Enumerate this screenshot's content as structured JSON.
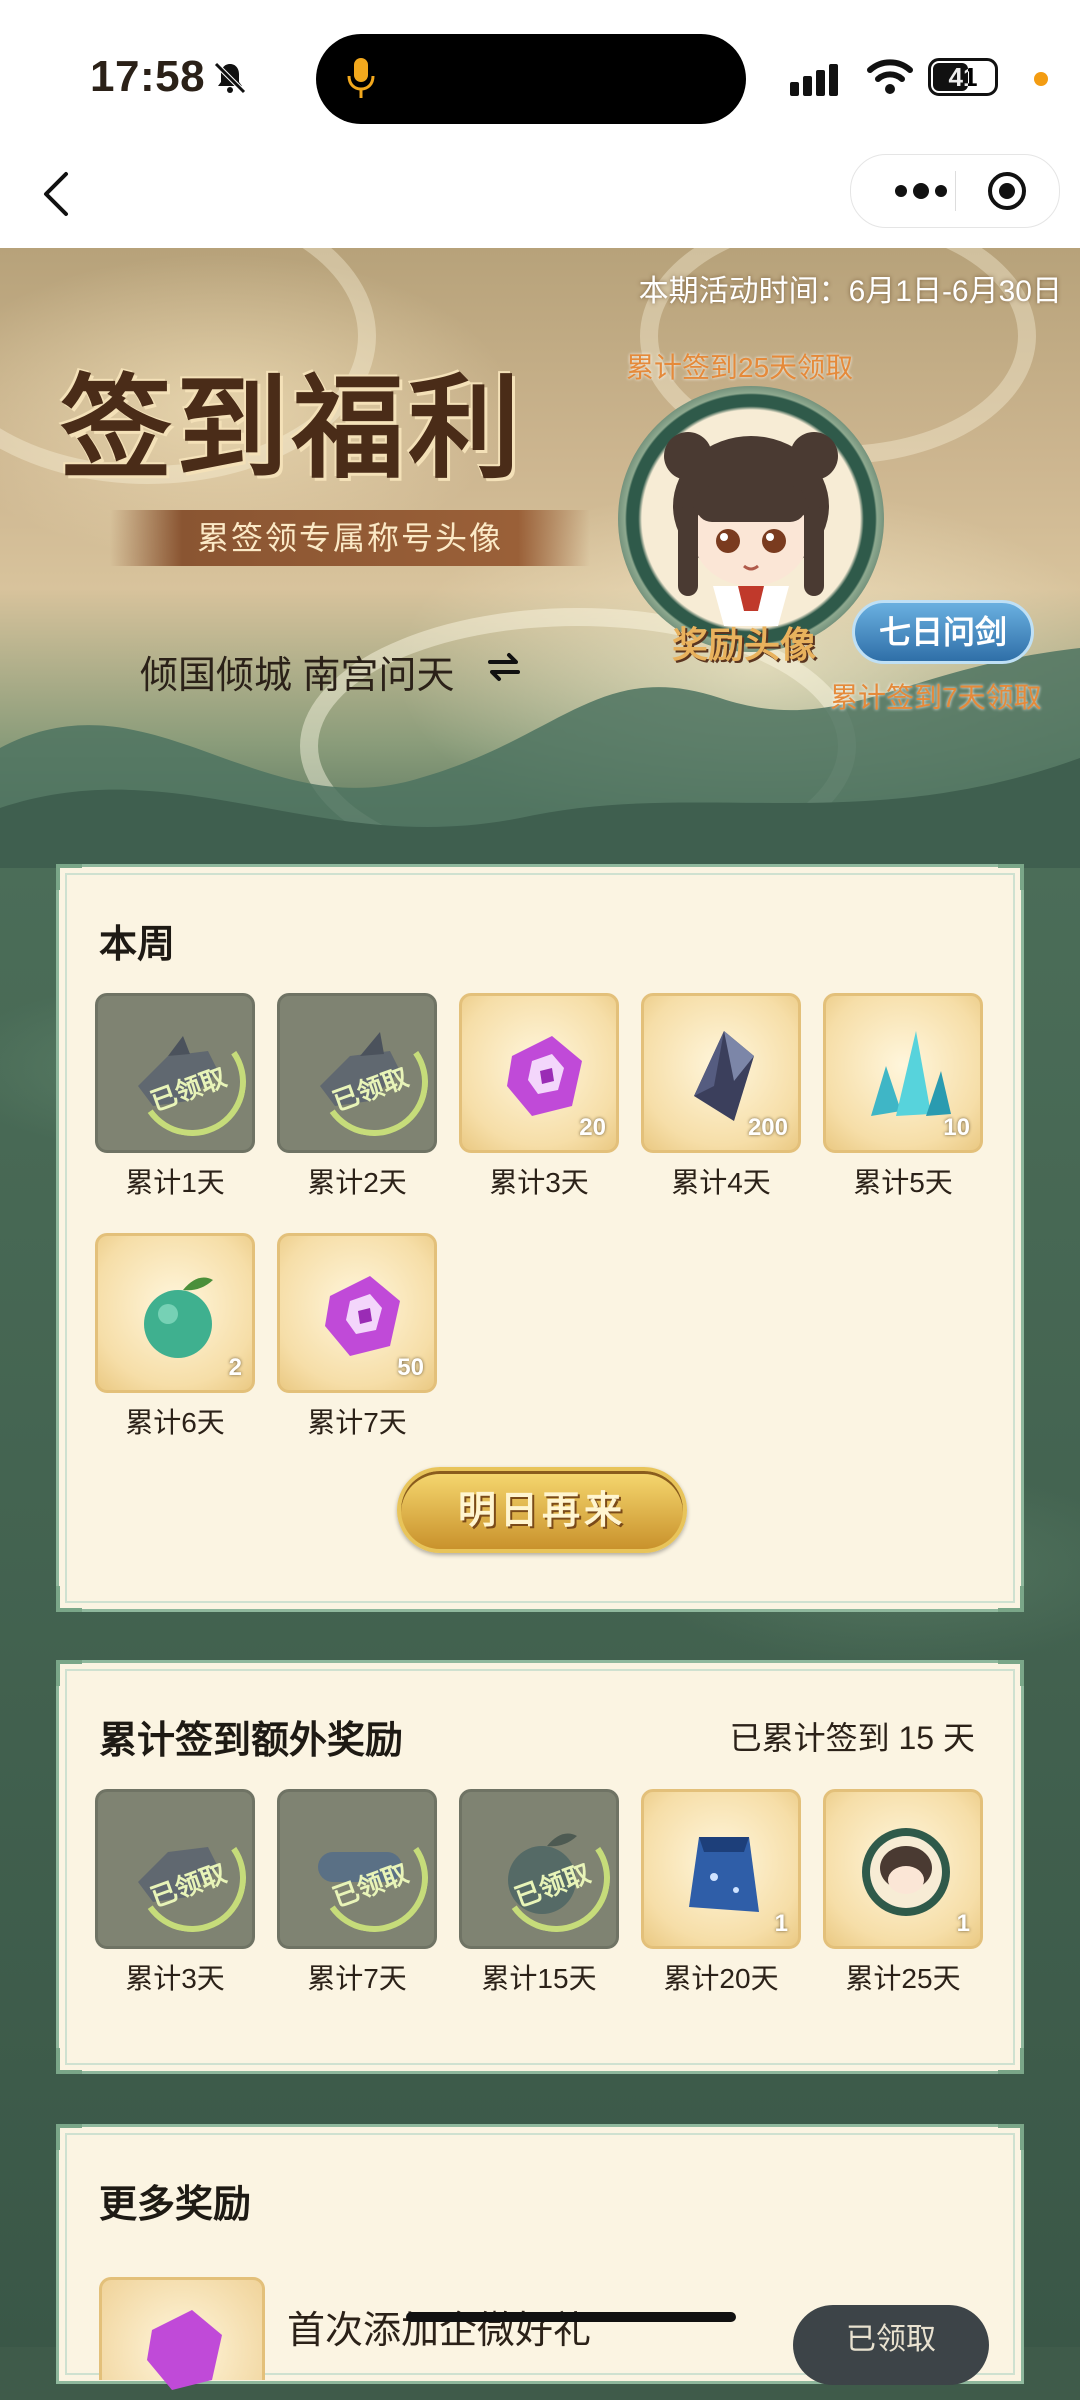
{
  "status_bar": {
    "time": "17:58",
    "battery": "41"
  },
  "banner": {
    "activity_time": "本期活动时间：6月1日-6月30日",
    "title": "签到福利",
    "subtitle": "累签领专属称号头像",
    "current_title": "倾国倾城 南宫问天",
    "cum25_note": "累计签到25天领取",
    "avatar_label": "奖励头像",
    "badge_label": "七日问剑",
    "cum7_note": "累计签到7天领取"
  },
  "week": {
    "title": "本周",
    "items": [
      {
        "label": "累计1天",
        "count": "",
        "claimed": true,
        "stamp": "已领取"
      },
      {
        "label": "累计2天",
        "count": "",
        "claimed": true,
        "stamp": "已领取"
      },
      {
        "label": "累计3天",
        "count": "20",
        "claimed": false,
        "icon": "purple-rune-icon"
      },
      {
        "label": "累计4天",
        "count": "200",
        "claimed": false,
        "icon": "dark-crystal-icon"
      },
      {
        "label": "累计5天",
        "count": "10",
        "claimed": false,
        "icon": "blue-crystal-icon"
      },
      {
        "label": "累计6天",
        "count": "2",
        "claimed": false,
        "icon": "green-fruit-icon"
      },
      {
        "label": "累计7天",
        "count": "50",
        "claimed": false,
        "icon": "purple-rune-icon"
      }
    ],
    "button_label": "明日再来"
  },
  "cumulative": {
    "title": "累计签到额外奖励",
    "progress": "已累计签到 15 天",
    "items": [
      {
        "label": "累计3天",
        "count": "",
        "claimed": true,
        "stamp": "已领取"
      },
      {
        "label": "累计7天",
        "count": "",
        "claimed": true,
        "stamp": "已领取"
      },
      {
        "label": "累计15天",
        "count": "",
        "claimed": true,
        "stamp": "已领取"
      },
      {
        "label": "累计20天",
        "count": "1",
        "claimed": false,
        "icon": "blue-cape-icon"
      },
      {
        "label": "累计25天",
        "count": "1",
        "claimed": false,
        "icon": "avatar-frame-icon"
      }
    ]
  },
  "more": {
    "title": "更多奖励",
    "first_item": "首次添加企微好礼",
    "button_label": "已领取"
  },
  "colors": {
    "card_bg": "#fbf4e2",
    "card_border": "#8fb89d",
    "accent_orange": "#e58a3a",
    "gold": "#c9922c"
  }
}
